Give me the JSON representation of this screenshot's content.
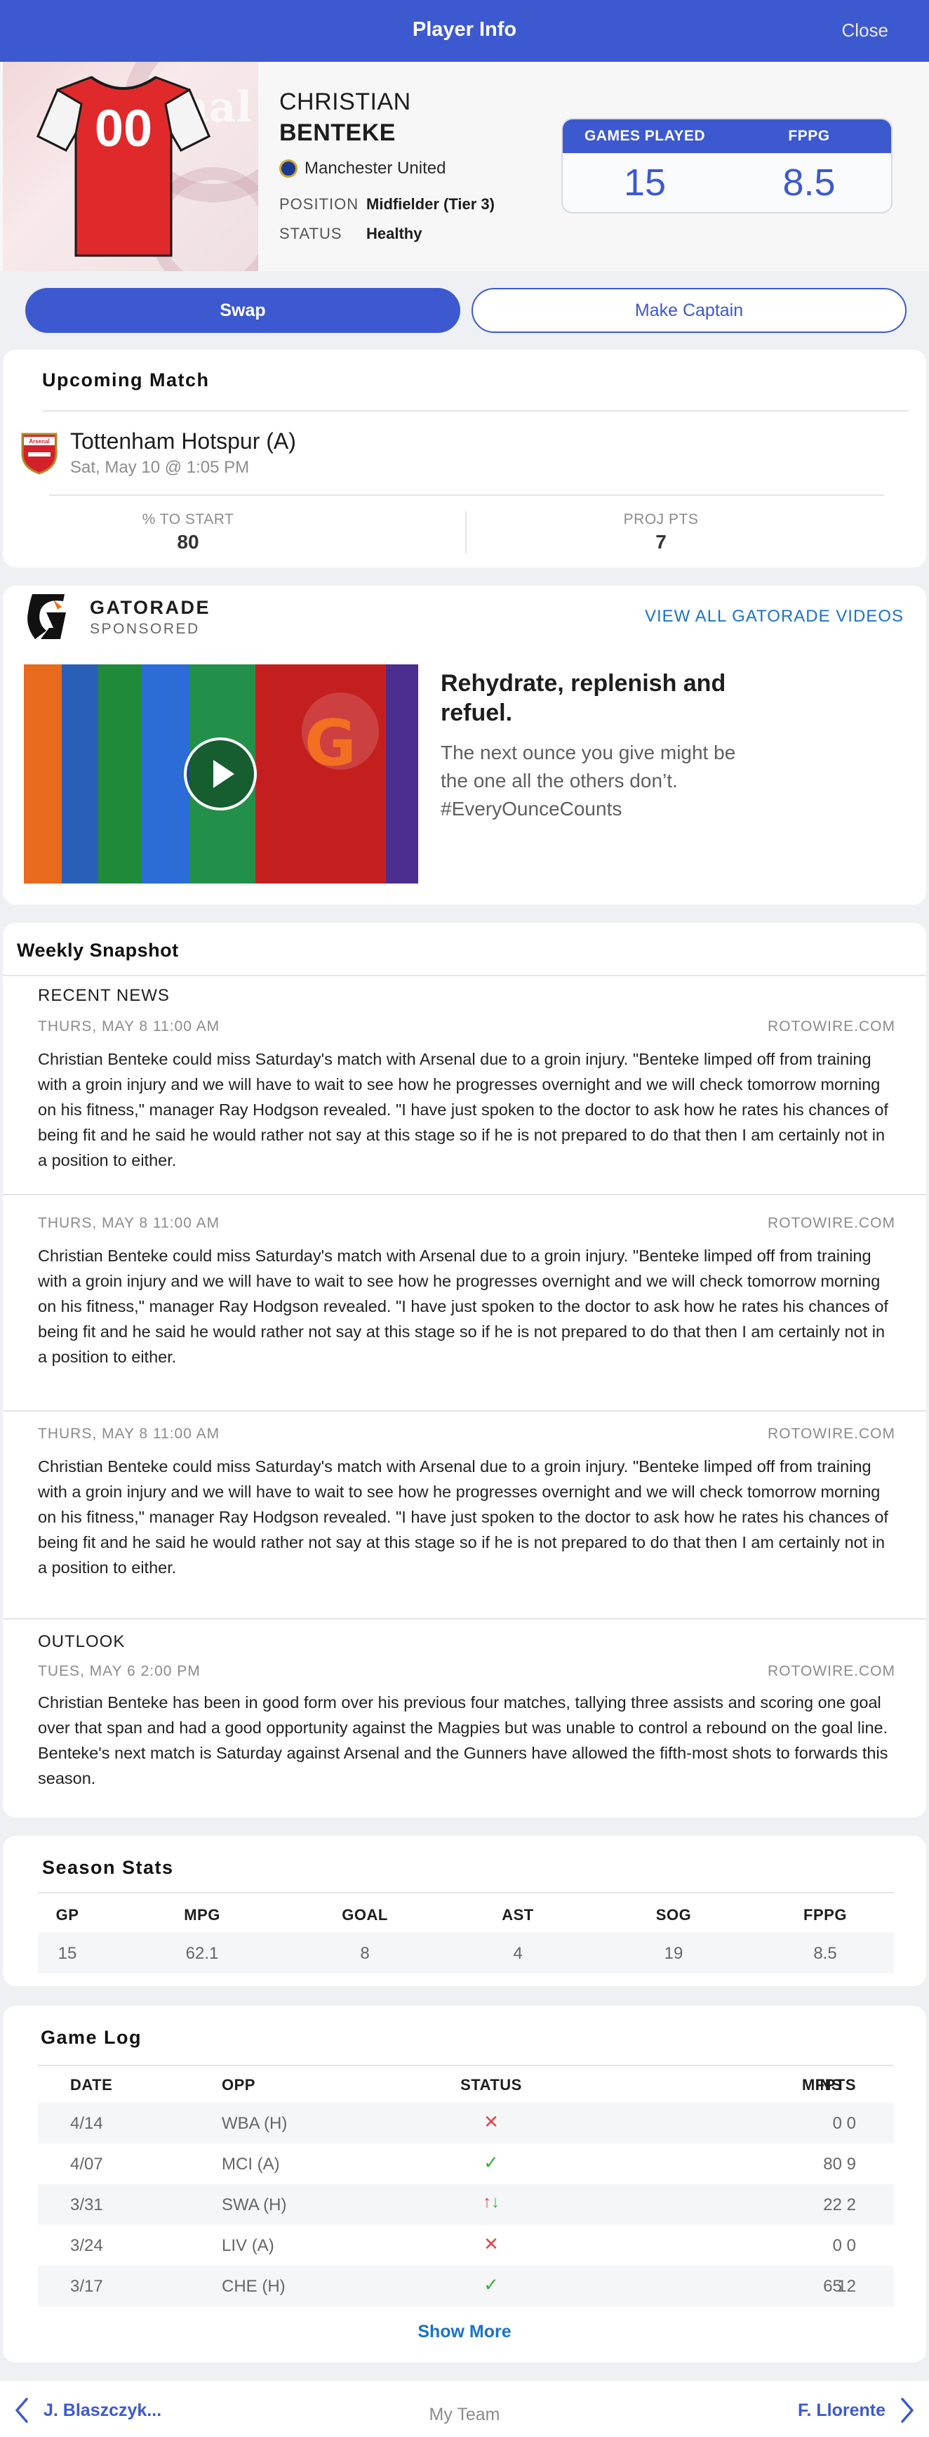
{
  "header": {
    "title": "Player Info",
    "close_label": "Close"
  },
  "player": {
    "jersey_number": "00",
    "first_name": "CHRISTIAN",
    "last_name": "BENTEKE",
    "club": "Manchester United",
    "position_label": "POSITION",
    "position_value": "Midfielder (Tier 3)",
    "status_label": "STATUS",
    "status_value": "Healthy",
    "crest_watermark": "nal",
    "stats": {
      "games_played_label": "GAMES PLAYED",
      "games_played": "15",
      "fppg_label": "FPPG",
      "fppg": "8.5"
    }
  },
  "actions": {
    "swap_label": "Swap",
    "captain_label": "Make Captain"
  },
  "upcoming": {
    "title": "Upcoming Match",
    "opponent": "Tottenham Hotspur (A)",
    "datetime": "Sat, May 10 @ 1:05 PM",
    "crest_text": "Arsenal",
    "start_label": "% TO START",
    "start_value": "80",
    "proj_label": "PROJ PTS",
    "proj_value": "7"
  },
  "sponsor": {
    "name": "GATORADE",
    "tag": "SPONSORED",
    "view_all": "VIEW ALL GATORADE VIDEOS",
    "headline": "Rehydrate, replenish and refuel.",
    "body": "The next ounce you give might be the one all the others don’t. #EveryOunceCounts"
  },
  "weekly": {
    "title": "Weekly Snapshot",
    "recent_label": "RECENT NEWS",
    "outlook_label": "OUTLOOK",
    "news": [
      {
        "date": "THURS, MAY 8 11:00 AM",
        "source": "ROTOWIRE.COM",
        "body": "Christian Benteke could miss Saturday's match with Arsenal due to a groin injury. \"Benteke limped off from training with a groin injury and we will have to wait to see how he progresses overnight and we will check tomorrow morning on his fitness,\" manager Ray Hodgson revealed. \"I have just spoken to the doctor to ask how he rates his chances of being fit and he said he would rather not say at this stage so if he is not prepared to do that then I am certainly not in a position to either."
      },
      {
        "date": "THURS, MAY 8 11:00 AM",
        "source": "ROTOWIRE.COM",
        "body": "Christian Benteke could miss Saturday's match with Arsenal due to a groin injury. \"Benteke limped off from training with a groin injury and we will have to wait to see how he progresses overnight and we will check tomorrow morning on his fitness,\" manager Ray Hodgson revealed. \"I have just spoken to the doctor to ask how he rates his chances of being fit and he said he would rather not say at this stage so if he is not prepared to do that then I am certainly not in a position to either."
      },
      {
        "date": "THURS, MAY 8 11:00 AM",
        "source": "ROTOWIRE.COM",
        "body": "Christian Benteke could miss Saturday's match with Arsenal due to a groin injury. \"Benteke limped off from training with a groin injury and we will have to wait to see how he progresses overnight and we will check tomorrow morning on his fitness,\" manager Ray Hodgson revealed. \"I have just spoken to the doctor to ask how he rates his chances of being fit and he said he would rather not say at this stage so if he is not prepared to do that then I am certainly not in a position to either."
      }
    ],
    "outlook": {
      "date": "TUES, MAY 6 2:00 PM",
      "source": "ROTOWIRE.COM",
      "body": "Christian Benteke has been in good form over his previous four matches, tallying three assists and scoring one goal over that span and had a good opportunity against the Magpies but was unable to control a rebound on the goal line. Benteke's next match is Saturday against Arsenal and the Gunners have allowed the fifth-most shots to forwards this season."
    }
  },
  "season_stats": {
    "title": "Season Stats",
    "headers": [
      "GP",
      "MPG",
      "GOAL",
      "AST",
      "SOG",
      "FPPG"
    ],
    "values": [
      "15",
      "62.1",
      "8",
      "4",
      "19",
      "8.5"
    ]
  },
  "game_log": {
    "title": "Game Log",
    "headers": [
      "DATE",
      "OPP",
      "STATUS",
      "MINS",
      "FPTS"
    ],
    "rows": [
      {
        "date": "4/14",
        "opp": "WBA (H)",
        "status": "out",
        "status_icon": "x-icon",
        "mins": "0",
        "fpts": "0"
      },
      {
        "date": "4/07",
        "opp": "MCI (A)",
        "status": "played",
        "status_icon": "check-icon",
        "mins": "80",
        "fpts": "9"
      },
      {
        "date": "3/31",
        "opp": "SWA (H)",
        "status": "sub",
        "status_icon": "swap-arrows-icon",
        "mins": "22",
        "fpts": "2"
      },
      {
        "date": "3/24",
        "opp": "LIV (A)",
        "status": "out",
        "status_icon": "x-icon",
        "mins": "0",
        "fpts": "0"
      },
      {
        "date": "3/17",
        "opp": "CHE (H)",
        "status": "played",
        "status_icon": "check-icon",
        "mins": "65",
        "fpts": "12"
      }
    ],
    "show_more": "Show More"
  },
  "footer": {
    "prev_label": "J. Blaszczyk...",
    "mid_label": "My Team",
    "next_label": "F. Llorente"
  },
  "colors": {
    "brand": "#3d59cf",
    "link": "#1a73c7",
    "jersey": "#e0292a",
    "out": "#e04848",
    "ok": "#3aae3c"
  }
}
